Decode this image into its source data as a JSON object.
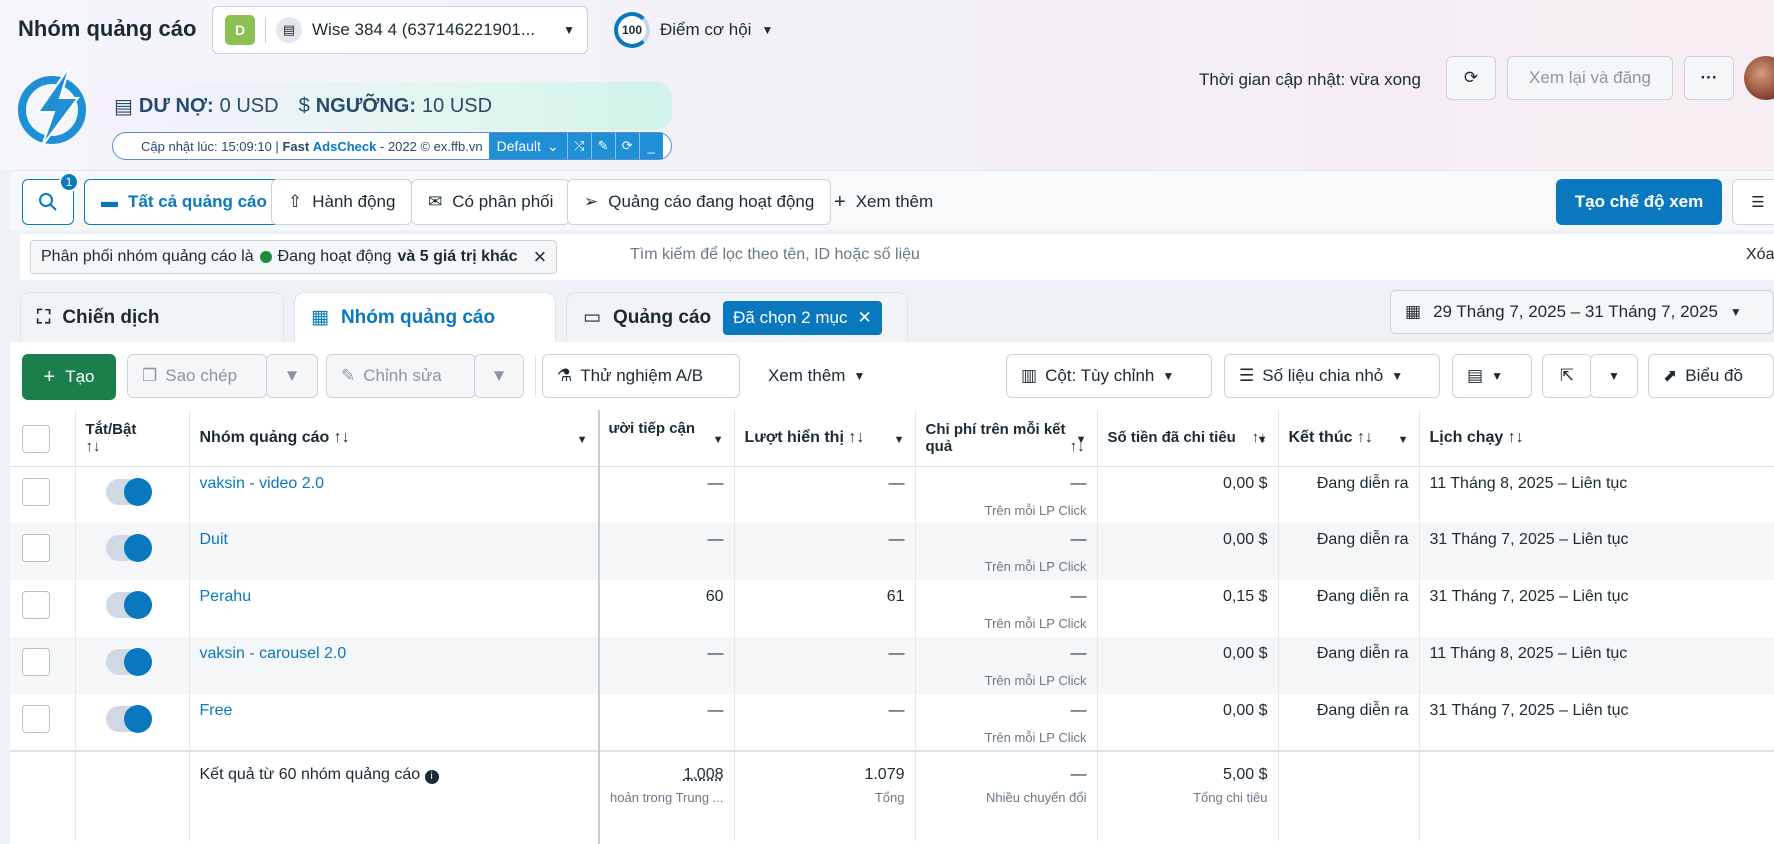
{
  "header": {
    "title": "Nhóm quảng cáo",
    "account": {
      "badge": "D",
      "name": "Wise 384 4 (637146221901..."
    },
    "opportunity": {
      "score": "100",
      "label": "Điểm cơ hội"
    },
    "update_time": "Thời gian cập nhật: vừa xong",
    "review_label": "Xem lại và đăng",
    "more_label": "···"
  },
  "extension": {
    "debt_label": "DƯ NỢ:",
    "debt_value": "0 USD",
    "threshold_label": "NGƯỠNG:",
    "threshold_value": "10 USD",
    "updated_text": "Cập nhật lúc: 15:09:10 |",
    "brand_fast": "Fast",
    "brand_ads": "AdsCheck",
    "copyright": "- 2022 © ex.ffb.vn",
    "profile": "Default"
  },
  "toolbar": {
    "search_badge": "1",
    "all_ads": "Tất cả quảng cáo",
    "actions": "Hành động",
    "delivered": "Có phân phối",
    "active_ads": "Quảng cáo đang hoạt động",
    "see_more": "Xem thêm",
    "create_view": "Tạo chế độ xem"
  },
  "filter": {
    "chip_prefix": "Phân phối nhóm quảng cáo là",
    "chip_value": "Đang hoạt động",
    "chip_more": "và 5 giá trị khác",
    "search_placeholder": "Tìm kiếm để lọc theo tên, ID hoặc số liệu",
    "clear": "Xóa"
  },
  "tabs": {
    "campaigns": "Chiến dịch",
    "adsets": "Nhóm quảng cáo",
    "ads": "Quảng cáo",
    "selected": "Đã chọn 2 mục"
  },
  "date_range": "29 Tháng 7, 2025 – 31 Tháng 7, 2025",
  "actionbar": {
    "create": "Tạo",
    "duplicate": "Sao chép",
    "edit": "Chỉnh sửa",
    "ab_test": "Thử nghiệm A/B",
    "see_more": "Xem thêm",
    "columns": "Cột: Tùy chỉnh",
    "breakdown": "Số liệu chia nhỏ",
    "charts": "Biểu đồ"
  },
  "table": {
    "headers": {
      "toggle": "Tắt/Bật",
      "name": "Nhóm quảng cáo",
      "reach": "ười tiếp cận",
      "impressions": "Lượt hiển thị",
      "cpr": "Chi phí trên mỗi kết quả",
      "spent": "Số tiền đã chi tiêu",
      "end": "Kết thúc",
      "schedule": "Lịch chạy"
    },
    "rows": [
      {
        "name": "vaksin - video 2.0",
        "reach": "—",
        "impressions": "—",
        "cpr": "—",
        "cpr_sub": "Trên mỗi LP Click",
        "spent": "0,00 $",
        "end": "Đang diễn ra",
        "schedule": "11 Tháng 8, 2025 – Liên tục"
      },
      {
        "name": "Duit",
        "reach": "—",
        "impressions": "—",
        "cpr": "—",
        "cpr_sub": "Trên mỗi LP Click",
        "spent": "0,00 $",
        "end": "Đang diễn ra",
        "schedule": "31 Tháng 7, 2025 – Liên tục"
      },
      {
        "name": "Perahu",
        "reach": "60",
        "impressions": "61",
        "cpr": "—",
        "cpr_sub": "Trên mỗi LP Click",
        "spent": "0,15 $",
        "end": "Đang diễn ra",
        "schedule": "31 Tháng 7, 2025 – Liên tục"
      },
      {
        "name": "vaksin - carousel 2.0",
        "reach": "—",
        "impressions": "—",
        "cpr": "—",
        "cpr_sub": "Trên mỗi LP Click",
        "spent": "0,00 $",
        "end": "Đang diễn ra",
        "schedule": "11 Tháng 8, 2025 – Liên tục"
      },
      {
        "name": "Free",
        "reach": "—",
        "impressions": "—",
        "cpr": "—",
        "cpr_sub": "Trên mỗi LP Click",
        "spent": "0,00 $",
        "end": "Đang diễn ra",
        "schedule": "31 Tháng 7, 2025 – Liên tục"
      }
    ],
    "totals": {
      "label": "Kết quả từ 60 nhóm quảng cáo",
      "reach": "1.008",
      "reach_sub": "hoản trong Trung ...",
      "impressions": "1.079",
      "impressions_sub": "Tổng",
      "cpr": "—",
      "cpr_sub": "Nhiều chuyển đổi",
      "spent": "5,00 $",
      "spent_sub": "Tổng chi tiêu"
    }
  }
}
